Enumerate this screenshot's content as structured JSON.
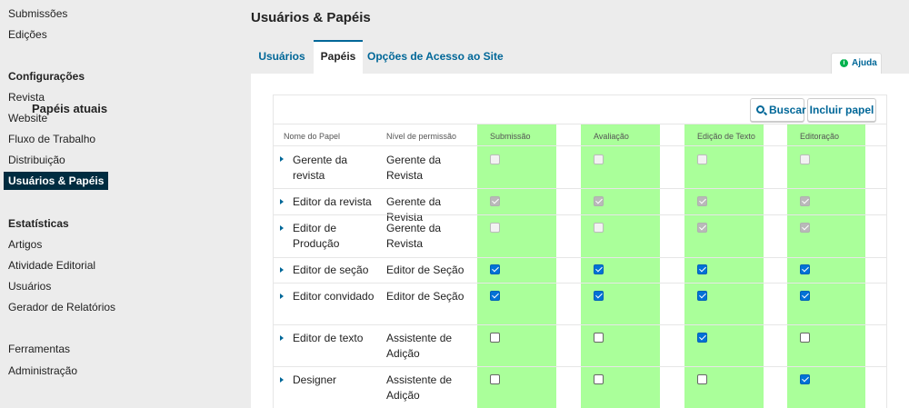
{
  "sidebar": {
    "top_items": [
      "Submissões",
      "Edições"
    ],
    "config_heading": "Configurações",
    "config_items": [
      "Revista",
      "Website",
      "Fluxo de Trabalho",
      "Distribuição",
      "Usuários & Papéis"
    ],
    "stats_heading": "Estatísticas",
    "stats_items": [
      "Artigos",
      "Atividade Editorial",
      "Usuários",
      "Gerador de Relatórios"
    ],
    "bottom_items": [
      "Ferramentas",
      "Administração"
    ]
  },
  "page_title": "Usuários & Papéis",
  "tabs": [
    "Usuários",
    "Papéis",
    "Opções de Acesso ao Site"
  ],
  "help_label": "Ajuda",
  "grid": {
    "title": "Papéis atuais",
    "search_label": "Buscar",
    "add_label": "Incluir papel",
    "columns": [
      "Nome do Papel",
      "Nível de permissão",
      "Submissão",
      "Avaliação",
      "Edição de Texto",
      "Editoração"
    ],
    "rows": [
      {
        "name": "Gerente da revista",
        "permission": "Gerente da Revista",
        "stages": [
          "disabled",
          "disabled",
          "disabled",
          "disabled"
        ]
      },
      {
        "name": "Editor da revista",
        "permission": "Gerente da Revista",
        "stages": [
          "disabled-checked",
          "disabled-checked",
          "disabled-checked",
          "disabled-checked"
        ]
      },
      {
        "name": "Editor de Produção",
        "permission": "Gerente da Revista",
        "stages": [
          "disabled",
          "disabled",
          "disabled-checked",
          "disabled-checked"
        ]
      },
      {
        "name": "Editor de seção",
        "permission": "Editor de Seção",
        "stages": [
          "checked",
          "checked",
          "checked",
          "checked"
        ]
      },
      {
        "name": "Editor convidado",
        "permission": "Editor de Seção",
        "stages": [
          "checked",
          "checked",
          "checked",
          "checked"
        ]
      },
      {
        "name": "Editor de texto",
        "permission": "Assistente de Adição",
        "stages": [
          "unchecked",
          "unchecked",
          "checked",
          "unchecked"
        ]
      },
      {
        "name": "Designer",
        "permission": "Assistente de Adição",
        "stages": [
          "unchecked",
          "unchecked",
          "unchecked",
          "checked"
        ]
      }
    ]
  },
  "colors": {
    "accent": "#006798",
    "highlight": "#aaff9a",
    "active_nav": "#002c40",
    "checkbox": "#0072d6"
  }
}
